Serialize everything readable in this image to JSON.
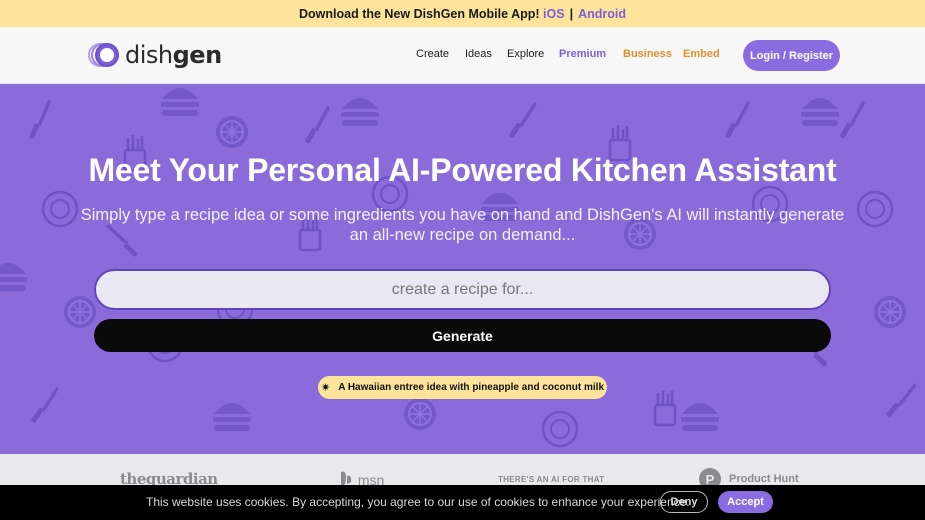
{
  "colors": {
    "brand_purple": "#8b6bd9",
    "accent_yellow": "#fde49a",
    "cta_black": "#0a0a0a",
    "business_orange": "#e0902b"
  },
  "top_banner": {
    "text": "Download the New DishGen Mobile App!",
    "ios_link": "iOS",
    "separator": "|",
    "android_link": "Android"
  },
  "header": {
    "logo_light": "dish",
    "logo_bold": "gen",
    "nav": {
      "create": "Create",
      "ideas": "Ideas",
      "explore": "Explore",
      "premium": "Premium",
      "business": "Business",
      "embed": "Embed"
    },
    "login_label": "Login / Register"
  },
  "hero": {
    "title": "Meet Your Personal AI-Powered Kitchen Assistant",
    "subtitle": "Simply type a recipe idea or some ingredients you have on hand and DishGen's AI will instantly generate an all-new recipe on demand...",
    "search_placeholder": "create a recipe for...",
    "generate_label": "Generate",
    "idea_icon": "sparkle-icon",
    "idea_chip": "A Hawaiian entree idea with pineapple and coconut milk"
  },
  "press": {
    "guardian": "theguardian",
    "msn": "msn",
    "ai_for_that": "THERE'S AN AI FOR THAT",
    "product_hunt_icon": "P",
    "product_hunt": "Product Hunt"
  },
  "cookie_banner": {
    "text": "This website uses cookies. By accepting, you agree to our use of cookies to enhance your experience.",
    "deny_label": "Deny",
    "accept_label": "Accept"
  }
}
